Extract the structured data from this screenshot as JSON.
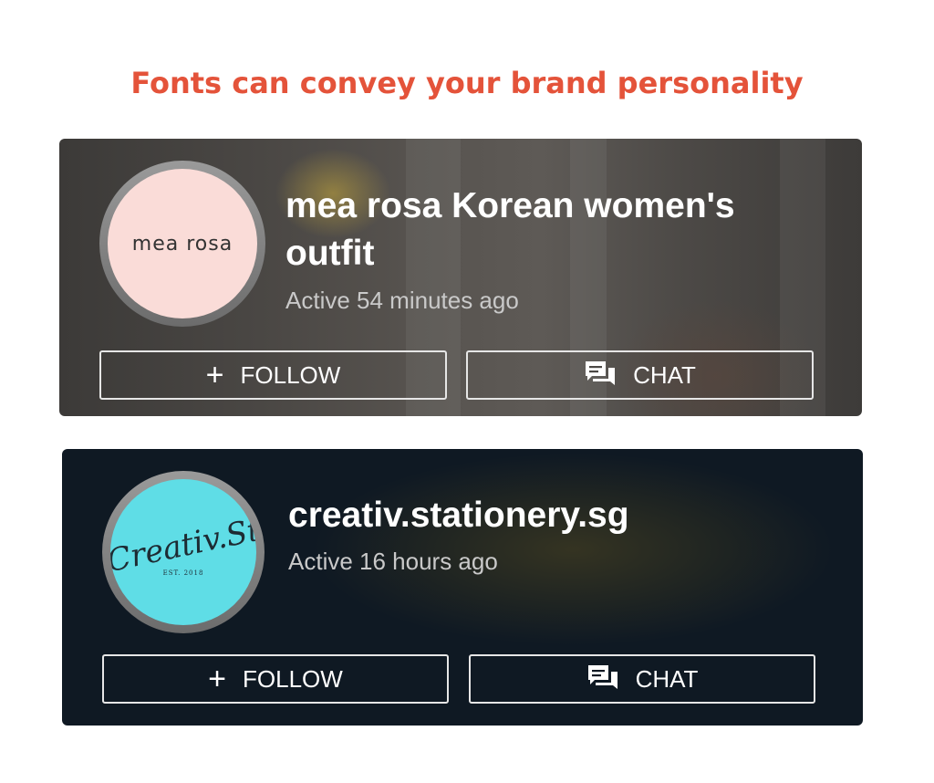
{
  "heading": "Fonts can convey your brand personality",
  "cards": [
    {
      "logo_text": "mea rosa",
      "shop_name": "mea rosa Korean women's outfit",
      "status": "Active 54 minutes ago",
      "follow_label": "FOLLOW",
      "chat_label": "CHAT"
    },
    {
      "logo_text": "Creativ.St",
      "logo_subtext": "EST. 2018",
      "shop_name": "creativ.stationery.sg",
      "status": "Active 16 hours ago",
      "follow_label": "FOLLOW",
      "chat_label": "CHAT"
    }
  ],
  "colors": {
    "heading": "#e4533a",
    "card1_avatar_bg": "#fadcd8",
    "card2_avatar_bg": "#5fdde6",
    "card2_bg": "#0f1923"
  },
  "icons": {
    "follow": "plus-icon",
    "chat": "chat-bubbles-icon"
  }
}
